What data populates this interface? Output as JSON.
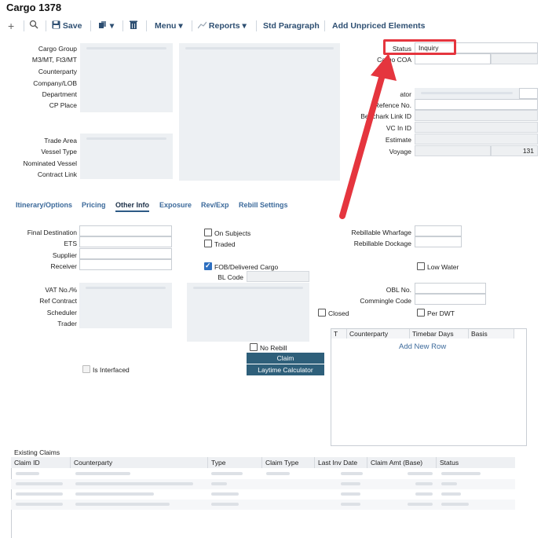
{
  "title": "Cargo 1378",
  "toolbar": {
    "save": "Save",
    "menu": "Menu",
    "reports": "Reports",
    "std_paragraph": "Std Paragraph",
    "add_unpriced": "Add Unpriced Elements"
  },
  "header_labels": {
    "cargo_group": "Cargo Group",
    "m3": "M3/MT, Ft3/MT",
    "counterparty": "Counterparty",
    "company_lob": "Company/LOB",
    "department": "Department",
    "cp_place": "CP Place",
    "trade_area": "Trade Area",
    "vessel_type": "Vessel Type",
    "nominated_vessel": "Nominated Vessel",
    "contract_link": "Contract Link"
  },
  "right_labels": {
    "status": "Status",
    "cargo_coa": "Cargo COA",
    "coordinator": "Coordinator",
    "coordinator_visible": "ator",
    "reference_no": "Reference No.",
    "reference_visible": "Refe",
    "reference_rest": "nce No.",
    "benchmark": "Benchmark Link ID",
    "benchmark_visible": "Bench",
    "benchmark_rest": "ark Link ID",
    "vc_in_id": "VC In ID",
    "estimate": "Estimate",
    "voyage": "Voyage"
  },
  "right_values": {
    "status": "Inquiry",
    "voyage": "131"
  },
  "tabs": [
    "Itinerary/Options",
    "Pricing",
    "Other Info",
    "Exposure",
    "Rev/Exp",
    "Rebill Settings"
  ],
  "other_info": {
    "final_destination": "Final Destination",
    "ets": "ETS",
    "supplier": "Supplier",
    "receiver": "Receiver",
    "vat": "VAT No./%",
    "ref_contract": "Ref Contract",
    "scheduler": "Scheduler",
    "trader": "Trader",
    "is_interfaced": "Is Interfaced",
    "on_subjects": "On Subjects",
    "traded": "Traded",
    "fob": "FOB/Delivered Cargo",
    "bl_code": "BL Code",
    "closed": "Closed",
    "no_rebill": "No Rebill",
    "claim_btn": "Claim",
    "laytime_btn": "Laytime Calculator",
    "rebillable_wharfage": "Rebillable Wharfage",
    "rebillable_dockage": "Rebillable Dockage",
    "low_water": "Low Water",
    "obl_no": "OBL No.",
    "commingle_code": "Commingle Code",
    "per_dwt": "Per DWT"
  },
  "counterparty_grid": {
    "columns": [
      "T",
      "Counterparty",
      "Timebar Days",
      "Basis"
    ],
    "add_row": "Add New Row"
  },
  "existing_claims": {
    "label": "Existing Claims",
    "columns": [
      "Claim ID",
      "Counterparty",
      "Type",
      "Claim Type",
      "Last Inv Date",
      "Claim Amt (Base)",
      "Status"
    ]
  },
  "colors": {
    "accent": "#2e5f7a",
    "highlight_box": "#e5353e",
    "tab_color": "#3c6a9b"
  }
}
